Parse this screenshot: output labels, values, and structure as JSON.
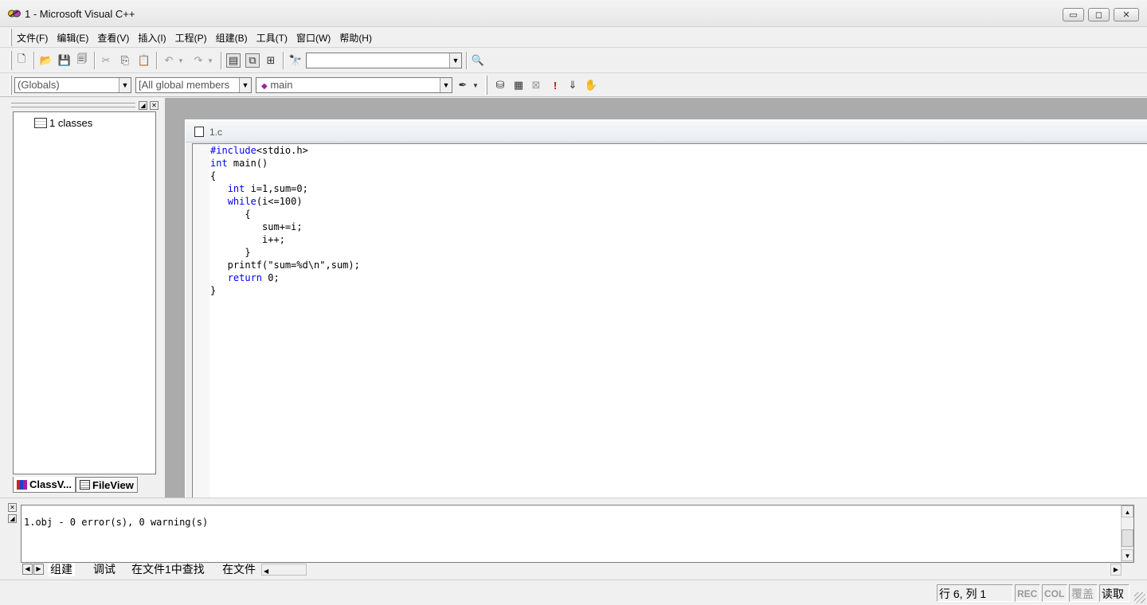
{
  "window": {
    "title": "1 - Microsoft Visual C++",
    "minimize_glyph": "▭",
    "maximize_glyph": "◻",
    "close_glyph": "✕"
  },
  "menu": {
    "items": [
      {
        "label": "文件(F)"
      },
      {
        "label": "编辑(E)"
      },
      {
        "label": "查看(V)"
      },
      {
        "label": "插入(I)"
      },
      {
        "label": "工程(P)"
      },
      {
        "label": "组建(B)"
      },
      {
        "label": "工具(T)"
      },
      {
        "label": "窗口(W)"
      },
      {
        "label": "帮助(H)"
      }
    ]
  },
  "toolbar_standard": {
    "find_combo_value": ""
  },
  "toolbar_wizard": {
    "class_combo": "(Globals)",
    "filter_combo": "[All global members",
    "member_combo": "main"
  },
  "workspace": {
    "tree_root": "1 classes",
    "tabs": [
      {
        "label": "ClassV..."
      },
      {
        "label": "FileView"
      }
    ]
  },
  "document": {
    "name": "1.c"
  },
  "output": {
    "text": "1.obj - 0 error(s), 0 warning(s)",
    "tabs": [
      {
        "label": "组建"
      },
      {
        "label": "调试"
      },
      {
        "label": "在文件1中查找"
      },
      {
        "label": "在文件"
      }
    ]
  },
  "status": {
    "position": "行 6, 列 1",
    "rec": "REC",
    "col": "COL",
    "ovr": "覆盖",
    "read": "读取"
  },
  "colors": {
    "keyword": "#0000ff",
    "mdi_background": "#ababab"
  }
}
